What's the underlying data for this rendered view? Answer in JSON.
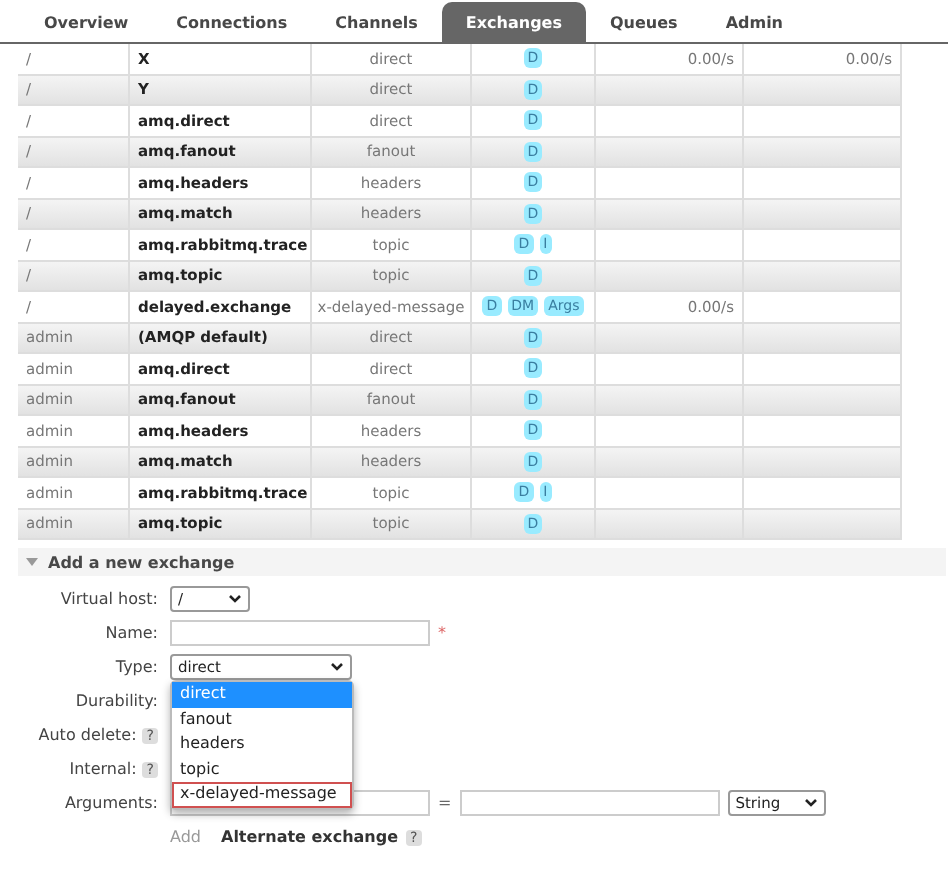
{
  "tabs": [
    {
      "label": "Overview",
      "selected": false
    },
    {
      "label": "Connections",
      "selected": false
    },
    {
      "label": "Channels",
      "selected": false
    },
    {
      "label": "Exchanges",
      "selected": true
    },
    {
      "label": "Queues",
      "selected": false
    },
    {
      "label": "Admin",
      "selected": false
    }
  ],
  "exchanges": [
    {
      "vhost": "/",
      "name": "X",
      "type": "direct",
      "features": [
        "D"
      ],
      "rate_in": "0.00/s",
      "rate_out": "0.00/s"
    },
    {
      "vhost": "/",
      "name": "Y",
      "type": "direct",
      "features": [
        "D"
      ]
    },
    {
      "vhost": "/",
      "name": "amq.direct",
      "type": "direct",
      "features": [
        "D"
      ]
    },
    {
      "vhost": "/",
      "name": "amq.fanout",
      "type": "fanout",
      "features": [
        "D"
      ]
    },
    {
      "vhost": "/",
      "name": "amq.headers",
      "type": "headers",
      "features": [
        "D"
      ]
    },
    {
      "vhost": "/",
      "name": "amq.match",
      "type": "headers",
      "features": [
        "D"
      ]
    },
    {
      "vhost": "/",
      "name": "amq.rabbitmq.trace",
      "type": "topic",
      "features": [
        "D",
        "I"
      ]
    },
    {
      "vhost": "/",
      "name": "amq.topic",
      "type": "topic",
      "features": [
        "D"
      ]
    },
    {
      "vhost": "/",
      "name": "delayed.exchange",
      "type": "x-delayed-message",
      "features": [
        "D",
        "DM",
        "Args"
      ],
      "rate_in": "0.00/s"
    },
    {
      "vhost": "admin",
      "name": "(AMQP default)",
      "type": "direct",
      "features": [
        "D"
      ]
    },
    {
      "vhost": "admin",
      "name": "amq.direct",
      "type": "direct",
      "features": [
        "D"
      ]
    },
    {
      "vhost": "admin",
      "name": "amq.fanout",
      "type": "fanout",
      "features": [
        "D"
      ]
    },
    {
      "vhost": "admin",
      "name": "amq.headers",
      "type": "headers",
      "features": [
        "D"
      ]
    },
    {
      "vhost": "admin",
      "name": "amq.match",
      "type": "headers",
      "features": [
        "D"
      ]
    },
    {
      "vhost": "admin",
      "name": "amq.rabbitmq.trace",
      "type": "topic",
      "features": [
        "D",
        "I"
      ]
    },
    {
      "vhost": "admin",
      "name": "amq.topic",
      "type": "topic",
      "features": [
        "D"
      ]
    }
  ],
  "add_exchange": {
    "title": "Add a new exchange",
    "expanded": true,
    "virtual_host": {
      "label": "Virtual host:",
      "value": "/"
    },
    "name": {
      "label": "Name:",
      "required_mark": "*"
    },
    "type": {
      "label": "Type:",
      "value": "direct",
      "options": [
        {
          "label": "direct",
          "selected": true,
          "outlined": false
        },
        {
          "label": "fanout",
          "selected": false,
          "outlined": false
        },
        {
          "label": "headers",
          "selected": false,
          "outlined": false
        },
        {
          "label": "topic",
          "selected": false,
          "outlined": false
        },
        {
          "label": "x-delayed-message",
          "selected": false,
          "outlined": true
        }
      ]
    },
    "durability": {
      "label": "Durability:"
    },
    "auto_delete": {
      "label": "Auto delete:",
      "help": "?"
    },
    "internal": {
      "label": "Internal:",
      "help": "?"
    },
    "arguments": {
      "label": "Arguments:",
      "equals": "=",
      "value_type": "String"
    },
    "add_link": "Add",
    "alternate_exchange": {
      "label": "Alternate exchange",
      "help": "?"
    }
  }
}
